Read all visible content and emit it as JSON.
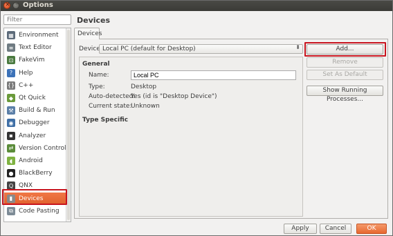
{
  "window": {
    "title": "Options"
  },
  "filter": {
    "placeholder": "Filter"
  },
  "nav": {
    "items": [
      {
        "label": "Environment",
        "icon": "environment-icon",
        "color": "#5d6b7a"
      },
      {
        "label": "Text Editor",
        "icon": "text-editor-icon",
        "color": "#6f7b82"
      },
      {
        "label": "FakeVim",
        "icon": "fakevim-icon",
        "color": "#4a7a3f"
      },
      {
        "label": "Help",
        "icon": "help-icon",
        "color": "#3c72b8"
      },
      {
        "label": "C++",
        "icon": "cpp-icon",
        "color": "#7a7a7a"
      },
      {
        "label": "Qt Quick",
        "icon": "qt-quick-icon",
        "color": "#6a9a3a"
      },
      {
        "label": "Build & Run",
        "icon": "build-run-icon",
        "color": "#5b7fa8"
      },
      {
        "label": "Debugger",
        "icon": "debugger-icon",
        "color": "#3f6fa6"
      },
      {
        "label": "Analyzer",
        "icon": "analyzer-icon",
        "color": "#333333"
      },
      {
        "label": "Version Control",
        "icon": "version-control-icon",
        "color": "#5b8c3a"
      },
      {
        "label": "Android",
        "icon": "android-icon",
        "color": "#7fb241"
      },
      {
        "label": "BlackBerry",
        "icon": "blackberry-icon",
        "color": "#222222"
      },
      {
        "label": "QNX",
        "icon": "qnx-icon",
        "color": "#444444"
      },
      {
        "label": "Devices",
        "icon": "devices-icon",
        "color": "#8a8a8a"
      },
      {
        "label": "Code Pasting",
        "icon": "code-pasting-icon",
        "color": "#7d8b96"
      }
    ],
    "selected": "Devices"
  },
  "main": {
    "title": "Devices",
    "tab": "Devices",
    "device_label": "Device:",
    "device_value": "Local PC (default for Desktop)",
    "buttons": {
      "add": "Add...",
      "remove": "Remove",
      "set_default": "Set As Default",
      "show_processes": "Show Running Processes..."
    },
    "general": {
      "title": "General",
      "name_label": "Name:",
      "name_value": "Local PC",
      "type_label": "Type:",
      "type_value": "Desktop",
      "auto_label": "Auto-detected:",
      "auto_value": "Yes (id is \"Desktop Device\")",
      "state_label": "Current state:",
      "state_value": "Unknown"
    },
    "type_specific": "Type Specific"
  },
  "footer": {
    "apply": "Apply",
    "cancel": "Cancel",
    "ok": "OK"
  },
  "colors": {
    "accent": "#e8672f",
    "highlight": "#c8141e"
  }
}
